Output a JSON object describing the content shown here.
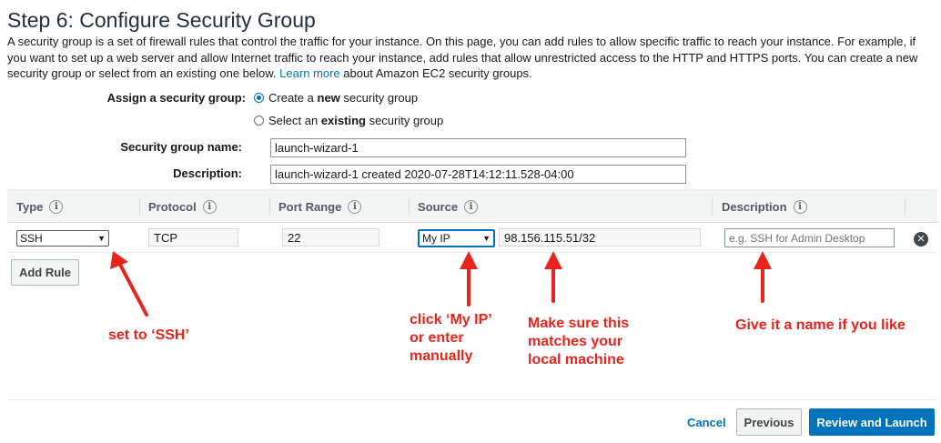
{
  "page": {
    "title": "Step 6: Configure Security Group",
    "intro_text": "A security group is a set of firewall rules that control the traffic for your instance. On this page, you can add rules to allow specific traffic to reach your instance. For example, if you want to set up a web server and allow Internet traffic to reach your instance, add rules that allow unrestricted access to the HTTP and HTTPS ports. You can create a new security group or select from an existing one below.",
    "learn_more_link": "Learn more",
    "intro_suffix": "about Amazon EC2 security groups."
  },
  "assign": {
    "label": "Assign a security group:",
    "option_create_prefix": "Create a",
    "option_create_bold": "new",
    "option_create_suffix": "security group",
    "option_existing_prefix": "Select an",
    "option_existing_bold": "existing",
    "option_existing_suffix": "security group",
    "selected": "create"
  },
  "group_name": {
    "label": "Security group name:",
    "value": "launch-wizard-1"
  },
  "description": {
    "label": "Description:",
    "value": "launch-wizard-1 created 2020-07-28T14:12:11.528-04:00"
  },
  "table": {
    "headers": {
      "type": "Type",
      "protocol": "Protocol",
      "port_range": "Port Range",
      "source": "Source",
      "description": "Description"
    },
    "info_glyph": "i",
    "rows": [
      {
        "type": "SSH",
        "protocol": "TCP",
        "port_range": "22",
        "source_select": "My IP",
        "source_value": "98.156.115.51/32",
        "description_placeholder": "e.g. SSH for Admin Desktop"
      }
    ],
    "remove_glyph": "✕"
  },
  "buttons": {
    "add_rule": "Add Rule",
    "cancel": "Cancel",
    "previous": "Previous",
    "review_launch": "Review and Launch"
  },
  "annotations": {
    "type_note": "set to ‘SSH’",
    "source_note_lines": [
      "click ‘My IP’",
      "or enter",
      "manually"
    ],
    "ip_note_lines": [
      "Make sure this",
      "matches your",
      "local machine"
    ],
    "desc_note": "Give it a name if you like",
    "color": "#e8251d"
  },
  "icons": {
    "info": "info-icon",
    "remove": "remove-circle-icon",
    "chevron": "chevron-down-icon",
    "arrow": "arrow-up-icon"
  },
  "colors": {
    "link": "#0073bb",
    "primary_button": "#0073bb",
    "annotation": "#e8251d"
  }
}
